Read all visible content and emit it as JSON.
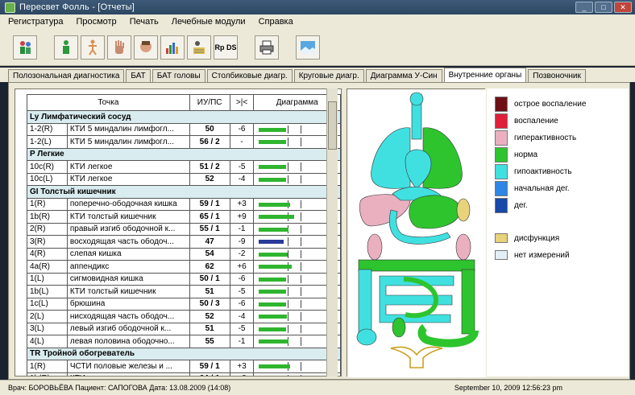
{
  "window": {
    "title": "Пересвет Фолль - [Отчеты]"
  },
  "menu": [
    "Регистратура",
    "Просмотр",
    "Печать",
    "Лечебные модули",
    "Справка"
  ],
  "toolbar": {
    "buttons": [
      {
        "icon": "patients-icon"
      },
      {
        "icon": "person-green-icon"
      },
      {
        "icon": "body-meridians-icon"
      },
      {
        "icon": "hand-icon"
      },
      {
        "icon": "head-profile-icon"
      },
      {
        "icon": "bar-chart-icon"
      },
      {
        "icon": "measurement-icon"
      },
      {
        "icon": "rp-ds-icon",
        "label": "Rp DS"
      },
      {
        "icon": "printer-icon"
      },
      {
        "icon": "picture-icon"
      }
    ]
  },
  "tabs": [
    "Полозональная диагностика",
    "БАТ",
    "БАТ головы",
    "Столбиковые диагр.",
    "Круговые диагр.",
    "Диаграмма У-Син",
    "Внутренние органы",
    "Позвоночник"
  ],
  "active_tab_index": 6,
  "table": {
    "headers": [
      "Точка",
      "ИУ/ПС",
      ">|<",
      "Диаграмма"
    ],
    "rows": [
      {
        "group": "Ly  Лимфатический сосуд"
      },
      {
        "code": "1-2(R)",
        "name": "КТИ 5 миндалин лимфогл...",
        "value": "50",
        "delta": "-6",
        "bar": 0.6,
        "color": "green"
      },
      {
        "code": "1-2(L)",
        "name": "КТИ 5 миндалин лимфогл...",
        "value": "56 / 2",
        "delta": "-",
        "bar": 0.6,
        "color": "green"
      },
      {
        "group": "P  Легкие"
      },
      {
        "code": "10c(R)",
        "name": "КТИ легкое",
        "value": "51 / 2",
        "delta": "-5",
        "bar": 0.6,
        "color": "green"
      },
      {
        "code": "10c(L)",
        "name": "КТИ легкое",
        "value": "52",
        "delta": "-4",
        "bar": 0.6,
        "color": "green"
      },
      {
        "group": "GI  Толстый кишечник"
      },
      {
        "code": "1(R)",
        "name": "поперечно-ободочная кишка",
        "value": "59 / 1",
        "delta": "+3",
        "bar": 0.7,
        "color": "green"
      },
      {
        "code": "1b(R)",
        "name": "КТИ толстый кишечник",
        "value": "65 / 1",
        "delta": "+9",
        "bar": 0.78,
        "color": "green"
      },
      {
        "code": "2(R)",
        "name": "правый изгиб ободочной к...",
        "value": "55 / 1",
        "delta": "-1",
        "bar": 0.66,
        "color": "green"
      },
      {
        "code": "3(R)",
        "name": "восходящая часть ободоч...",
        "value": "47",
        "delta": "-9",
        "bar": 0.56,
        "color": "blue"
      },
      {
        "code": "4(R)",
        "name": "слепая кишка",
        "value": "54",
        "delta": "-2",
        "bar": 0.64,
        "color": "green"
      },
      {
        "code": "4a(R)",
        "name": "аппендикс",
        "value": "62",
        "delta": "+6",
        "bar": 0.74,
        "color": "green"
      },
      {
        "code": "1(L)",
        "name": "сигмовидная кишка",
        "value": "50 / 1",
        "delta": "-6",
        "bar": 0.6,
        "color": "green"
      },
      {
        "code": "1b(L)",
        "name": "КТИ толстый кишечник",
        "value": "51",
        "delta": "-5",
        "bar": 0.6,
        "color": "green"
      },
      {
        "code": "1c(L)",
        "name": "брюшина",
        "value": "50 / 3",
        "delta": "-6",
        "bar": 0.6,
        "color": "green"
      },
      {
        "code": "2(L)",
        "name": "нисходящая часть ободоч...",
        "value": "52",
        "delta": "-4",
        "bar": 0.62,
        "color": "green"
      },
      {
        "code": "3(L)",
        "name": "левый изгиб ободочной к...",
        "value": "51",
        "delta": "-5",
        "bar": 0.6,
        "color": "green"
      },
      {
        "code": "4(L)",
        "name": "левая половина ободочно...",
        "value": "55",
        "delta": "-1",
        "bar": 0.66,
        "color": "green"
      },
      {
        "group": "TR  Тройной обогреватель"
      },
      {
        "code": "1(R)",
        "name": "ЧСТИ половые железы и ...",
        "value": "59 / 1",
        "delta": "+3",
        "bar": 0.7,
        "color": "green"
      },
      {
        "code": "1b(R)",
        "name": "КТИ эндокринная система",
        "value": "64 / 1",
        "delta": "+8",
        "bar": 0.76,
        "color": "green"
      }
    ]
  },
  "legend": {
    "items": [
      {
        "label": "острое воспаление",
        "color": "#6e0f16"
      },
      {
        "label": "воспаление",
        "color": "#e0203a"
      },
      {
        "label": "гиперактивность",
        "color": "#eab0c0"
      },
      {
        "label": "норма",
        "color": "#2ec42e"
      },
      {
        "label": "гипоактивность",
        "color": "#40e0e0"
      },
      {
        "label": "начальная дег.",
        "color": "#2e86e6"
      },
      {
        "label": "дег.",
        "color": "#1848a8"
      }
    ],
    "extra": [
      {
        "label": "дисфункция",
        "color": "#e8d27a"
      },
      {
        "label": "нет измерений",
        "color": "#e4eef6"
      }
    ]
  },
  "status": {
    "left": "Врач: БОРОВЬЁВА   Пациент: САПОГОВА   Дата: 13.08.2009  (14:08)",
    "right": "September 10, 2009 12:56:23 pm"
  }
}
